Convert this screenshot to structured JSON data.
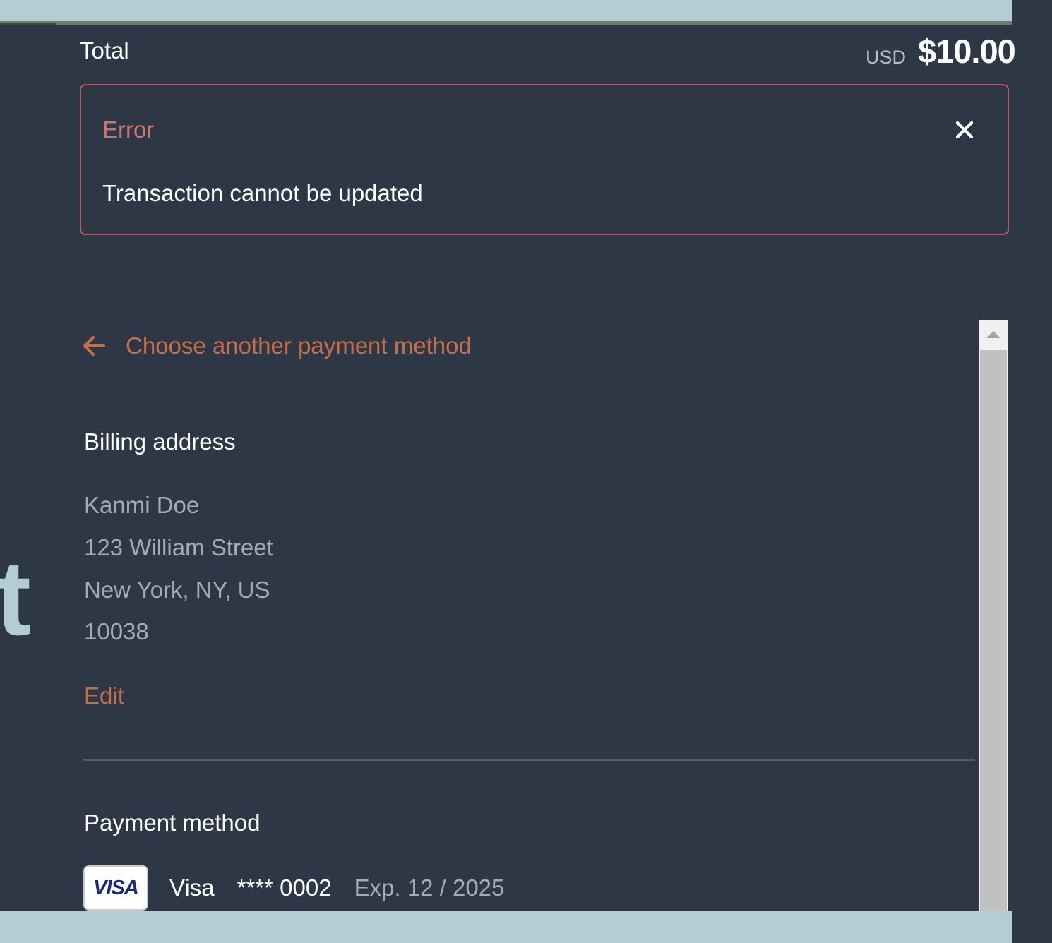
{
  "summary": {
    "total_label": "Total",
    "currency": "USD",
    "amount": "$10.00"
  },
  "error": {
    "title": "Error",
    "message": "Transaction cannot be updated",
    "close_icon": "close-icon"
  },
  "navigation": {
    "back_label": "Choose another payment method",
    "back_icon": "arrow-left-icon"
  },
  "billing": {
    "heading": "Billing address",
    "name": "Kanmi Doe",
    "street": "123 William Street",
    "city_line": "New York, NY, US",
    "postal_code": "10038",
    "edit_label": "Edit"
  },
  "payment": {
    "heading": "Payment method",
    "logo_text": "VISA",
    "brand": "Visa",
    "masked_number": "**** 0002",
    "expiry": "Exp. 12 / 2025"
  },
  "background": {
    "partial_glyph": "t"
  },
  "colors": {
    "background": "#2e3745",
    "accent": "#c66d4a",
    "error_border": "#b75a57",
    "error_text": "#d1716b",
    "band": "#b4cdd4"
  }
}
